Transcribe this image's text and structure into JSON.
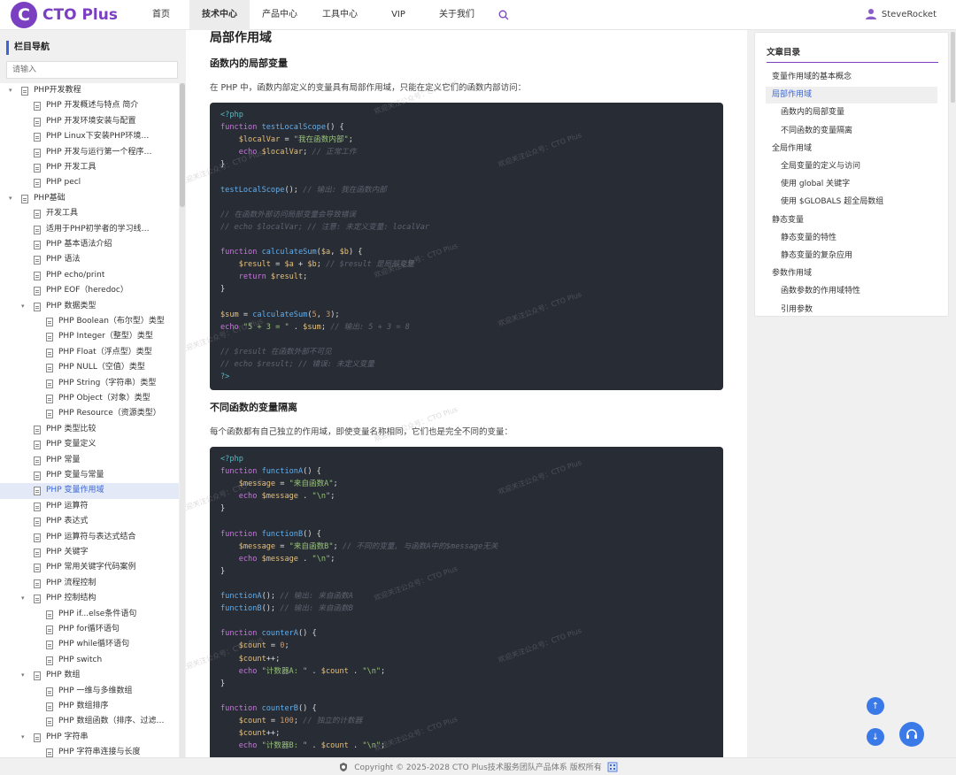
{
  "brand": {
    "mark": "C",
    "name": "CTO Plus"
  },
  "nav": [
    {
      "label": "首页",
      "active": false
    },
    {
      "label": "技术中心",
      "active": true
    },
    {
      "label": "产品中心",
      "active": false
    },
    {
      "label": "工具中心",
      "active": false
    },
    {
      "label": "VIP",
      "active": false
    },
    {
      "label": "关于我们",
      "active": false
    }
  ],
  "user": {
    "name": "SteveRocket"
  },
  "sidebar": {
    "title": "栏目导航",
    "search_placeholder": "请输入",
    "items": [
      {
        "label": "PHP开发教程",
        "level": 0,
        "folder": true
      },
      {
        "label": "PHP 开发概述与特点 简介",
        "level": 1
      },
      {
        "label": "PHP 开发环境安装与配置",
        "level": 1
      },
      {
        "label": "PHP Linux下安装PHP环境…",
        "level": 1
      },
      {
        "label": "PHP 开发与运行第一个程序…",
        "level": 1
      },
      {
        "label": "PHP 开发工具",
        "level": 1
      },
      {
        "label": "PHP pecl",
        "level": 1
      },
      {
        "label": "PHP基础",
        "level": 0,
        "folder": true
      },
      {
        "label": "开发工具",
        "level": 1
      },
      {
        "label": "适用于PHP初学者的学习线…",
        "level": 1
      },
      {
        "label": "PHP 基本语法介绍",
        "level": 1
      },
      {
        "label": "PHP 语法",
        "level": 1
      },
      {
        "label": "PHP echo/print",
        "level": 1
      },
      {
        "label": "PHP EOF（heredoc）",
        "level": 1
      },
      {
        "label": "PHP 数据类型",
        "level": 1,
        "folder": true
      },
      {
        "label": "PHP Boolean（布尔型）类型",
        "level": 2
      },
      {
        "label": "PHP Integer（整型）类型",
        "level": 2
      },
      {
        "label": "PHP Float（浮点型）类型",
        "level": 2
      },
      {
        "label": "PHP NULL（空值）类型",
        "level": 2
      },
      {
        "label": "PHP String（字符串）类型",
        "level": 2
      },
      {
        "label": "PHP Object（对象）类型",
        "level": 2
      },
      {
        "label": "PHP Resource（资源类型）",
        "level": 2
      },
      {
        "label": "PHP 类型比较",
        "level": 1
      },
      {
        "label": "PHP 变量定义",
        "level": 1
      },
      {
        "label": "PHP 常量",
        "level": 1
      },
      {
        "label": "PHP 变量与常量",
        "level": 1
      },
      {
        "label": "PHP 变量作用域",
        "level": 1,
        "active": true
      },
      {
        "label": "PHP 运算符",
        "level": 1
      },
      {
        "label": "PHP 表达式",
        "level": 1
      },
      {
        "label": "PHP 运算符与表达式结合",
        "level": 1
      },
      {
        "label": "PHP 关键字",
        "level": 1
      },
      {
        "label": "PHP 常用关键字代码案例",
        "level": 1
      },
      {
        "label": "PHP 流程控制",
        "level": 1
      },
      {
        "label": "PHP 控制结构",
        "level": 1,
        "folder": true
      },
      {
        "label": "PHP if...else条件语句",
        "level": 2
      },
      {
        "label": "PHP for循环语句",
        "level": 2
      },
      {
        "label": "PHP while循环语句",
        "level": 2
      },
      {
        "label": "PHP switch",
        "level": 2
      },
      {
        "label": "PHP 数组",
        "level": 1,
        "folder": true
      },
      {
        "label": "PHP 一维与多维数组",
        "level": 2
      },
      {
        "label": "PHP 数组排序",
        "level": 2
      },
      {
        "label": "PHP 数组函数（排序、过滤…",
        "level": 2
      },
      {
        "label": "PHP 字符串",
        "level": 1,
        "folder": true
      },
      {
        "label": "PHP 字符串连接与长度",
        "level": 2
      }
    ]
  },
  "article": {
    "h2": "局部作用域",
    "s1_title": "函数内的局部变量",
    "s1_para": "在 PHP 中，函数内部定义的变量具有局部作用域，只能在定义它们的函数内部访问：",
    "code1": [
      [
        [
          "<?php",
          "tag"
        ]
      ],
      [
        [
          "function ",
          "kw"
        ],
        [
          "testLocalScope",
          "fn"
        ],
        [
          "() {",
          "pl"
        ]
      ],
      [
        [
          "    $localVar",
          "var"
        ],
        [
          " = ",
          "pl"
        ],
        [
          "\"我在函数内部\"",
          "str"
        ],
        [
          ";",
          "pl"
        ]
      ],
      [
        [
          "    echo ",
          "kw"
        ],
        [
          "$localVar",
          "var"
        ],
        [
          "; ",
          "pl"
        ],
        [
          "// 正常工作",
          "cm"
        ]
      ],
      [
        [
          "}",
          "pl"
        ]
      ],
      [
        [
          "",
          ""
        ]
      ],
      [
        [
          "testLocalScope",
          "fn"
        ],
        [
          "(); ",
          "pl"
        ],
        [
          "// 输出: 我在函数内部",
          "cm"
        ]
      ],
      [
        [
          "",
          ""
        ]
      ],
      [
        [
          "// 在函数外部访问局部变量会导致错误",
          "cm"
        ]
      ],
      [
        [
          "// echo $localVar; // 注意: 未定义变量: localVar",
          "cm"
        ]
      ],
      [
        [
          "",
          ""
        ]
      ],
      [
        [
          "function ",
          "kw"
        ],
        [
          "calculateSum",
          "fn"
        ],
        [
          "(",
          "pl"
        ],
        [
          "$a",
          "var"
        ],
        [
          ", ",
          "pl"
        ],
        [
          "$b",
          "var"
        ],
        [
          ") {",
          "pl"
        ]
      ],
      [
        [
          "    $result",
          "var"
        ],
        [
          " = ",
          "pl"
        ],
        [
          "$a",
          "var"
        ],
        [
          " + ",
          "pl"
        ],
        [
          "$b",
          "var"
        ],
        [
          "; ",
          "pl"
        ],
        [
          "// $result 是局部变量",
          "cm"
        ]
      ],
      [
        [
          "    return ",
          "kw"
        ],
        [
          "$result",
          "var"
        ],
        [
          ";",
          "pl"
        ]
      ],
      [
        [
          "}",
          "pl"
        ]
      ],
      [
        [
          "",
          ""
        ]
      ],
      [
        [
          "$sum",
          "var"
        ],
        [
          " = ",
          "pl"
        ],
        [
          "calculateSum",
          "fn"
        ],
        [
          "(",
          "pl"
        ],
        [
          "5",
          "num"
        ],
        [
          ", ",
          "pl"
        ],
        [
          "3",
          "num"
        ],
        [
          ");",
          "pl"
        ]
      ],
      [
        [
          "echo ",
          "kw"
        ],
        [
          "\"5 + 3 = \"",
          "str"
        ],
        [
          " . ",
          "pl"
        ],
        [
          "$sum",
          "var"
        ],
        [
          "; ",
          "pl"
        ],
        [
          "// 输出: 5 + 3 = 8",
          "cm"
        ]
      ],
      [
        [
          "",
          ""
        ]
      ],
      [
        [
          "// $result 在函数外部不可见",
          "cm"
        ]
      ],
      [
        [
          "// echo $result; // 错误: 未定义变量",
          "cm"
        ]
      ],
      [
        [
          "?>",
          "tag"
        ]
      ]
    ],
    "s2_title": "不同函数的变量隔离",
    "s2_para": "每个函数都有自己独立的作用域，即使变量名称相同，它们也是完全不同的变量：",
    "code2": [
      [
        [
          "<?php",
          "tag"
        ]
      ],
      [
        [
          "function ",
          "kw"
        ],
        [
          "functionA",
          "fn"
        ],
        [
          "() {",
          "pl"
        ]
      ],
      [
        [
          "    $message",
          "var"
        ],
        [
          " = ",
          "pl"
        ],
        [
          "\"来自函数A\"",
          "str"
        ],
        [
          ";",
          "pl"
        ]
      ],
      [
        [
          "    echo ",
          "kw"
        ],
        [
          "$message",
          "var"
        ],
        [
          " . ",
          "pl"
        ],
        [
          "\"\\n\"",
          "str"
        ],
        [
          ";",
          "pl"
        ]
      ],
      [
        [
          "}",
          "pl"
        ]
      ],
      [
        [
          "",
          ""
        ]
      ],
      [
        [
          "function ",
          "kw"
        ],
        [
          "functionB",
          "fn"
        ],
        [
          "() {",
          "pl"
        ]
      ],
      [
        [
          "    $message",
          "var"
        ],
        [
          " = ",
          "pl"
        ],
        [
          "\"来自函数B\"",
          "str"
        ],
        [
          "; ",
          "pl"
        ],
        [
          "// 不同的变量, 与函数A中的$message无关",
          "cm"
        ]
      ],
      [
        [
          "    echo ",
          "kw"
        ],
        [
          "$message",
          "var"
        ],
        [
          " . ",
          "pl"
        ],
        [
          "\"\\n\"",
          "str"
        ],
        [
          ";",
          "pl"
        ]
      ],
      [
        [
          "}",
          "pl"
        ]
      ],
      [
        [
          "",
          ""
        ]
      ],
      [
        [
          "functionA",
          "fn"
        ],
        [
          "(); ",
          "pl"
        ],
        [
          "// 输出: 来自函数A",
          "cm"
        ]
      ],
      [
        [
          "functionB",
          "fn"
        ],
        [
          "(); ",
          "pl"
        ],
        [
          "// 输出: 来自函数B",
          "cm"
        ]
      ],
      [
        [
          "",
          ""
        ]
      ],
      [
        [
          "function ",
          "kw"
        ],
        [
          "counterA",
          "fn"
        ],
        [
          "() {",
          "pl"
        ]
      ],
      [
        [
          "    $count",
          "var"
        ],
        [
          " = ",
          "pl"
        ],
        [
          "0",
          "num"
        ],
        [
          ";",
          "pl"
        ]
      ],
      [
        [
          "    $count",
          "var"
        ],
        [
          "++;",
          "pl"
        ]
      ],
      [
        [
          "    echo ",
          "kw"
        ],
        [
          "\"计数器A: \"",
          "str"
        ],
        [
          " . ",
          "pl"
        ],
        [
          "$count",
          "var"
        ],
        [
          " . ",
          "pl"
        ],
        [
          "\"\\n\"",
          "str"
        ],
        [
          ";",
          "pl"
        ]
      ],
      [
        [
          "}",
          "pl"
        ]
      ],
      [
        [
          "",
          ""
        ]
      ],
      [
        [
          "function ",
          "kw"
        ],
        [
          "counterB",
          "fn"
        ],
        [
          "() {",
          "pl"
        ]
      ],
      [
        [
          "    $count",
          "var"
        ],
        [
          " = ",
          "pl"
        ],
        [
          "100",
          "num"
        ],
        [
          "; ",
          "pl"
        ],
        [
          "// 独立的计数器",
          "cm"
        ]
      ],
      [
        [
          "    $count",
          "var"
        ],
        [
          "++;",
          "pl"
        ]
      ],
      [
        [
          "    echo ",
          "kw"
        ],
        [
          "\"计数器B: \"",
          "str"
        ],
        [
          " . ",
          "pl"
        ],
        [
          "$count",
          "var"
        ],
        [
          " . ",
          "pl"
        ],
        [
          "\"\\n\"",
          "str"
        ],
        [
          ";",
          "pl"
        ]
      ]
    ]
  },
  "watermark": "欢迎关注公众号：CTO Plus",
  "toc": {
    "title": "文章目录",
    "items": [
      {
        "label": "变量作用域的基本概念",
        "level": 0
      },
      {
        "label": "局部作用域",
        "level": 0,
        "active": true
      },
      {
        "label": "函数内的局部变量",
        "level": 1
      },
      {
        "label": "不同函数的变量隔离",
        "level": 1
      },
      {
        "label": "全局作用域",
        "level": 0
      },
      {
        "label": "全局变量的定义与访问",
        "level": 1
      },
      {
        "label": "使用 global 关键字",
        "level": 1
      },
      {
        "label": "使用 $GLOBALS 超全局数组",
        "level": 1
      },
      {
        "label": "静态变量",
        "level": 0
      },
      {
        "label": "静态变量的特性",
        "level": 1
      },
      {
        "label": "静态变量的复杂应用",
        "level": 1
      },
      {
        "label": "参数作用域",
        "level": 0
      },
      {
        "label": "函数参数的作用域特性",
        "level": 1
      },
      {
        "label": "引用参数",
        "level": 1
      }
    ]
  },
  "fab": {
    "up": "↑",
    "down": "↓"
  },
  "footer": {
    "text": "Copyright © 2025-2028 CTO Plus技术服务团队产品体系 版权所有"
  },
  "colors": {
    "brand": "#7b3fc1",
    "accent": "#3a66d6",
    "code_bg": "#282c34"
  }
}
